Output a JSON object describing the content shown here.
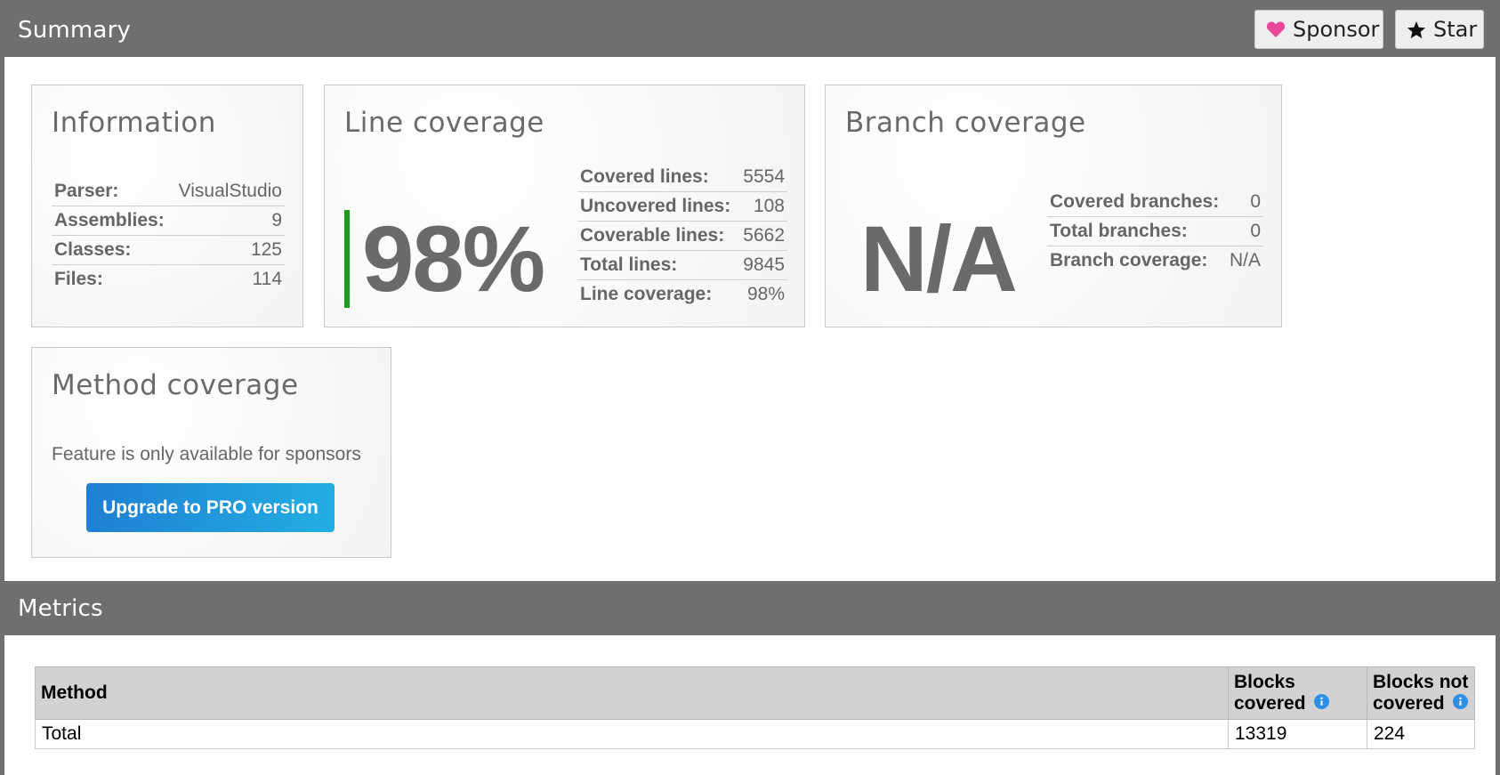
{
  "header": {
    "title": "Summary",
    "sponsor_label": "Sponsor",
    "star_label": "Star",
    "sponsor_icon": "heart-icon",
    "sponsor_icon_color": "#e8479a",
    "star_icon": "star-icon"
  },
  "information": {
    "title": "Information",
    "rows": [
      {
        "key": "Parser:",
        "value": "VisualStudio"
      },
      {
        "key": "Assemblies:",
        "value": "9"
      },
      {
        "key": "Classes:",
        "value": "125"
      },
      {
        "key": "Files:",
        "value": "114"
      }
    ]
  },
  "line_coverage": {
    "title": "Line coverage",
    "big_value": "98%",
    "bar_color": "#1a9e1a",
    "rows": [
      {
        "key": "Covered lines:",
        "value": "5554"
      },
      {
        "key": "Uncovered lines:",
        "value": "108"
      },
      {
        "key": "Coverable lines:",
        "value": "5662"
      },
      {
        "key": "Total lines:",
        "value": "9845"
      },
      {
        "key": "Line coverage:",
        "value": "98%"
      }
    ]
  },
  "branch_coverage": {
    "title": "Branch coverage",
    "big_value": "N/A",
    "rows": [
      {
        "key": "Covered branches:",
        "value": "0"
      },
      {
        "key": "Total branches:",
        "value": "0"
      },
      {
        "key": "Branch coverage:",
        "value": "N/A"
      }
    ]
  },
  "method_coverage": {
    "title": "Method coverage",
    "note": "Feature is only available for sponsors",
    "upgrade_label": "Upgrade to PRO version"
  },
  "metrics": {
    "title": "Metrics",
    "columns": [
      "Method",
      "Blocks covered",
      "Blocks not covered"
    ],
    "col_1_line1": "Blocks",
    "col_1_line2": "covered",
    "col_2_line1": "Blocks not",
    "col_2_line2": "covered",
    "info_icon": "info-icon",
    "info_icon_color": "#2e8fe6",
    "rows": [
      {
        "method": "Total",
        "blocks_covered": "13319",
        "blocks_not_covered": "224"
      }
    ]
  }
}
